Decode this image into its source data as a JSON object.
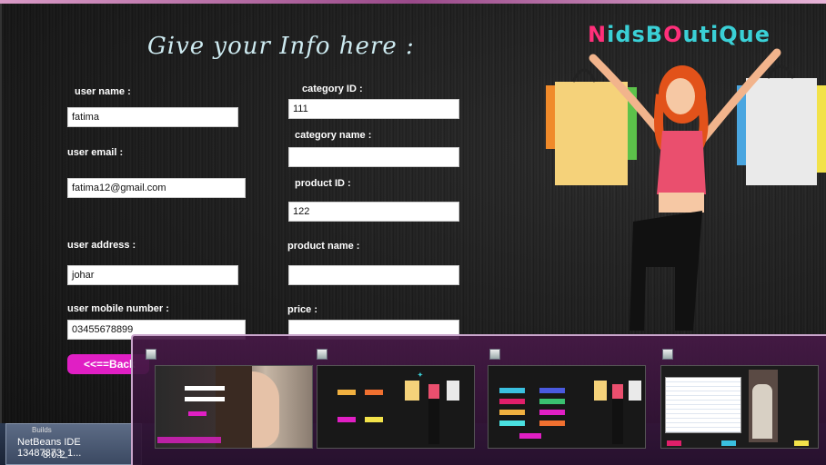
{
  "form": {
    "title": "Give your Info here :",
    "user_name_label": "user name :",
    "user_name_value": "fatima",
    "user_email_label": "user email :",
    "user_email_value": "fatima12@gmail.com",
    "user_address_label": "user address :",
    "user_address_value": "johar",
    "user_mobile_label": "user mobile number :",
    "user_mobile_value": "03455678899",
    "category_id_label": "category ID :",
    "category_id_value": "111",
    "category_name_label": "category name :",
    "category_name_value": "",
    "product_id_label": "product ID :",
    "product_id_value": "122",
    "product_name_label": "product name :",
    "product_name_value": "",
    "price_label": "price :",
    "price_value": "",
    "back_button_label": "<<==Back"
  },
  "logo": {
    "first": "N",
    "text": "idsB",
    "mid": "O",
    "rest": "utiQue"
  },
  "taskbar": {
    "small_text": "Builds",
    "app_line1": "NetBeans IDE  13487373_1...",
    "app_line2": "8.0.2"
  },
  "switcher": {
    "thumbnails": [
      {
        "name": "login-window"
      },
      {
        "name": "category-window"
      },
      {
        "name": "products-window"
      },
      {
        "name": "table-window"
      }
    ]
  },
  "colors": {
    "accent": "#e01fc4",
    "logo_cyan": "#3ad0d6",
    "logo_pink": "#ff2f7a",
    "title": "#cdeaf0"
  }
}
